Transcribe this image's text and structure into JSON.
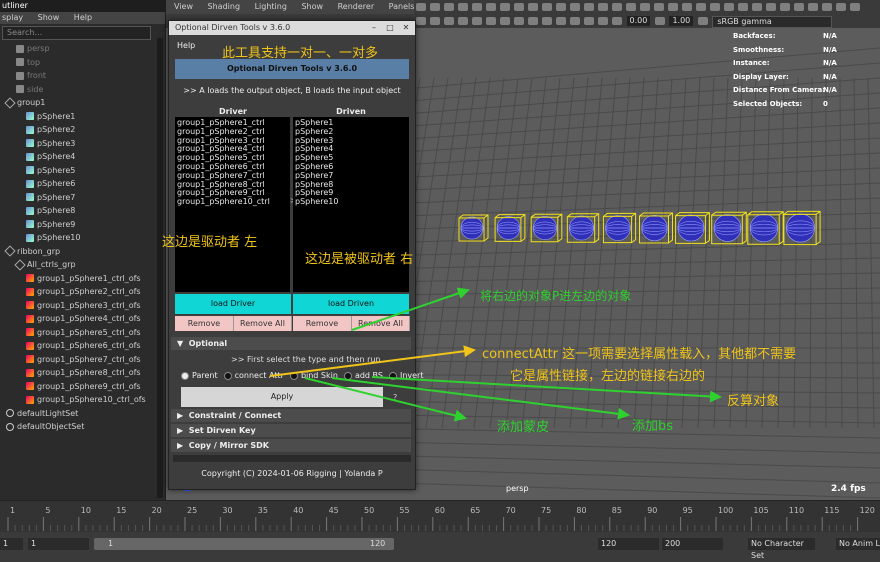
{
  "outliner": {
    "title": "utliner",
    "menu": [
      "splay",
      "Show",
      "Help"
    ],
    "search_placeholder": "Search...",
    "items": [
      {
        "label": "persp",
        "indent": 1,
        "icon": "camera-icon",
        "dim": true
      },
      {
        "label": "top",
        "indent": 1,
        "icon": "camera-icon",
        "dim": true
      },
      {
        "label": "front",
        "indent": 1,
        "icon": "camera-icon",
        "dim": true
      },
      {
        "label": "side",
        "indent": 1,
        "icon": "camera-icon",
        "dim": true
      },
      {
        "label": "group1",
        "indent": 0,
        "icon": "group-icon",
        "dim": false
      },
      {
        "label": "pSphere1",
        "indent": 2,
        "icon": "mesh-icon",
        "dim": false
      },
      {
        "label": "pSphere2",
        "indent": 2,
        "icon": "mesh-icon",
        "dim": false
      },
      {
        "label": "pSphere3",
        "indent": 2,
        "icon": "mesh-icon",
        "dim": false
      },
      {
        "label": "pSphere4",
        "indent": 2,
        "icon": "mesh-icon",
        "dim": false
      },
      {
        "label": "pSphere5",
        "indent": 2,
        "icon": "mesh-icon",
        "dim": false
      },
      {
        "label": "pSphere6",
        "indent": 2,
        "icon": "mesh-icon",
        "dim": false
      },
      {
        "label": "pSphere7",
        "indent": 2,
        "icon": "mesh-icon",
        "dim": false
      },
      {
        "label": "pSphere8",
        "indent": 2,
        "icon": "mesh-icon",
        "dim": false
      },
      {
        "label": "pSphere9",
        "indent": 2,
        "icon": "mesh-icon",
        "dim": false
      },
      {
        "label": "pSphere10",
        "indent": 2,
        "icon": "mesh-icon",
        "dim": false
      },
      {
        "label": "ribbon_grp",
        "indent": 0,
        "icon": "group-icon",
        "dim": false
      },
      {
        "label": "All_ctrls_grp",
        "indent": 1,
        "icon": "group-icon",
        "dim": false
      },
      {
        "label": "group1_pSphere1_ctrl_ofs",
        "indent": 2,
        "icon": "curve-icon",
        "dim": false
      },
      {
        "label": "group1_pSphere2_ctrl_ofs",
        "indent": 2,
        "icon": "curve-icon",
        "dim": false
      },
      {
        "label": "group1_pSphere3_ctrl_ofs",
        "indent": 2,
        "icon": "curve-icon",
        "dim": false
      },
      {
        "label": "group1_pSphere4_ctrl_ofs",
        "indent": 2,
        "icon": "curve-icon",
        "dim": false
      },
      {
        "label": "group1_pSphere5_ctrl_ofs",
        "indent": 2,
        "icon": "curve-icon",
        "dim": false
      },
      {
        "label": "group1_pSphere6_ctrl_ofs",
        "indent": 2,
        "icon": "curve-icon",
        "dim": false
      },
      {
        "label": "group1_pSphere7_ctrl_ofs",
        "indent": 2,
        "icon": "curve-icon",
        "dim": false
      },
      {
        "label": "group1_pSphere8_ctrl_ofs",
        "indent": 2,
        "icon": "curve-icon",
        "dim": false
      },
      {
        "label": "group1_pSphere9_ctrl_ofs",
        "indent": 2,
        "icon": "curve-icon",
        "dim": false
      },
      {
        "label": "group1_pSphere10_ctrl_ofs",
        "indent": 2,
        "icon": "curve-icon",
        "dim": false
      },
      {
        "label": "defaultLightSet",
        "indent": 0,
        "icon": "set-icon",
        "dim": false
      },
      {
        "label": "defaultObjectSet",
        "indent": 0,
        "icon": "set-icon",
        "dim": false
      }
    ]
  },
  "viewport": {
    "menu": [
      "View",
      "Shading",
      "Lighting",
      "Show",
      "Renderer",
      "Panels"
    ],
    "exposure": "0.00",
    "gamma": "1.00",
    "colorspace": "sRGB gamma",
    "camera_label": "persp",
    "fps": "2.4 fps",
    "hud": [
      {
        "k": "Backfaces:",
        "v": "N/A"
      },
      {
        "k": "Smoothness:",
        "v": "N/A"
      },
      {
        "k": "Instance:",
        "v": "N/A"
      },
      {
        "k": "Display Layer:",
        "v": "N/A"
      },
      {
        "k": "Distance From Camera:",
        "v": "N/A"
      },
      {
        "k": "Selected Objects:",
        "v": "0"
      }
    ]
  },
  "tool": {
    "window_title": "Optional Dirven Tools v 3.6.0",
    "help": "Help",
    "banner": "Optional Dirven Tools v 3.6.0",
    "instruction": ">> A loads the output object, B loads the input object",
    "driver_header": "Driver",
    "driven_header": "Driven",
    "driver_items": [
      "group1_pSphere1_ctrl",
      "group1_pSphere2_ctrl",
      "group1_pSphere3_ctrl",
      "group1_pSphere4_ctrl",
      "group1_pSphere5_ctrl",
      "group1_pSphere6_ctrl",
      "group1_pSphere7_ctrl",
      "group1_pSphere8_ctrl",
      "group1_pSphere9_ctrl",
      "group1_pSphere10_ctrl"
    ],
    "driven_items": [
      "pSphere1",
      "pSphere2",
      "pSphere3",
      "pSphere4",
      "pSphere5",
      "pSphere6",
      "pSphere7",
      "pSphere8",
      "pSphere9",
      "pSphere10"
    ],
    "load_driver": "load Driver",
    "load_driven": "load Driven",
    "remove": "Remove",
    "remove_all": "Remove All",
    "optional": "Optional",
    "select_hint": ">> First select the type and then run",
    "radios": [
      {
        "label": "Parent",
        "on": true
      },
      {
        "label": "connect Attr",
        "on": false
      },
      {
        "label": "bind Skin",
        "on": false
      },
      {
        "label": "add BS",
        "on": false
      },
      {
        "label": "Invert",
        "on": false
      }
    ],
    "apply": "Apply",
    "question": "?",
    "frames": [
      "Constraint / Connect",
      "Set Dirven Key",
      "Copy / Mirror SDK"
    ],
    "copyright": "Copyright (C)  2024-01-06  Rigging  | Yolanda P"
  },
  "annotations": {
    "support": "此工具支持一对一、一对多",
    "left": "这边是驱动者  左",
    "right": "这边是被驱动者  右",
    "right_to_left": "将右边的对象P进左边的对象",
    "connect_attr_1": "connectAttr 这一项需要选择属性载入，其他都不需要",
    "connect_attr_2": "它是属性链接，左边的链接右边的",
    "invert": "反算对象",
    "skin": "添加蒙皮",
    "bs": "添加bs",
    "color_yellow": "#f0c419",
    "color_green": "#2fd12f"
  },
  "timeline": {
    "ticks": [
      "1",
      "5",
      "10",
      "15",
      "20",
      "25",
      "30",
      "35",
      "40",
      "45",
      "50",
      "55",
      "60",
      "65",
      "70",
      "75",
      "80",
      "85",
      "90",
      "95",
      "100",
      "105",
      "110",
      "115",
      "120"
    ],
    "range_start_outer": "1",
    "range_start": "1",
    "range_slider_start": "1",
    "range_slider_end": "120",
    "range_end": "120",
    "range_end_outer": "200",
    "character_set": "No Character Set",
    "anim_layer": "No Anim Lay"
  }
}
